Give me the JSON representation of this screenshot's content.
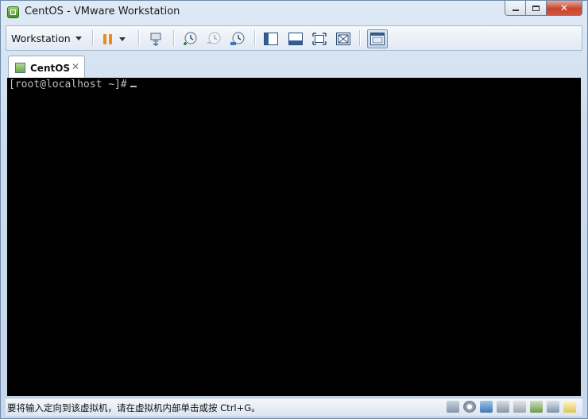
{
  "window": {
    "title": "CentOS - VMware Workstation"
  },
  "toolbar": {
    "menu_label": "Workstation",
    "icons": [
      "pause-icon",
      "dropdown-icon",
      "send-ctrl-alt-del-icon",
      "snapshot-icon",
      "revert-snapshot-icon",
      "snapshot-manager-icon",
      "thumbnail-bar-icon",
      "library-icon",
      "fullscreen-icon",
      "unity-icon",
      "console-view-icon"
    ]
  },
  "tabs": [
    {
      "label": "CentOS",
      "active": true
    }
  ],
  "console": {
    "prompt": "[root@localhost ~]#"
  },
  "statusbar": {
    "message": "要将输入定向到该虚拟机，请在虚拟机内部单击或按 Ctrl+G。",
    "icons": [
      "hdd-icon",
      "cdrom-icon",
      "network-icon",
      "usb-icon",
      "sound-icon",
      "printer-icon",
      "display-icon",
      "message-icon"
    ]
  },
  "colors": {
    "console_bg": "#000000",
    "console_text": "#bdbdbd",
    "pause_orange": "#e98a22",
    "close_red": "#c9452f"
  }
}
